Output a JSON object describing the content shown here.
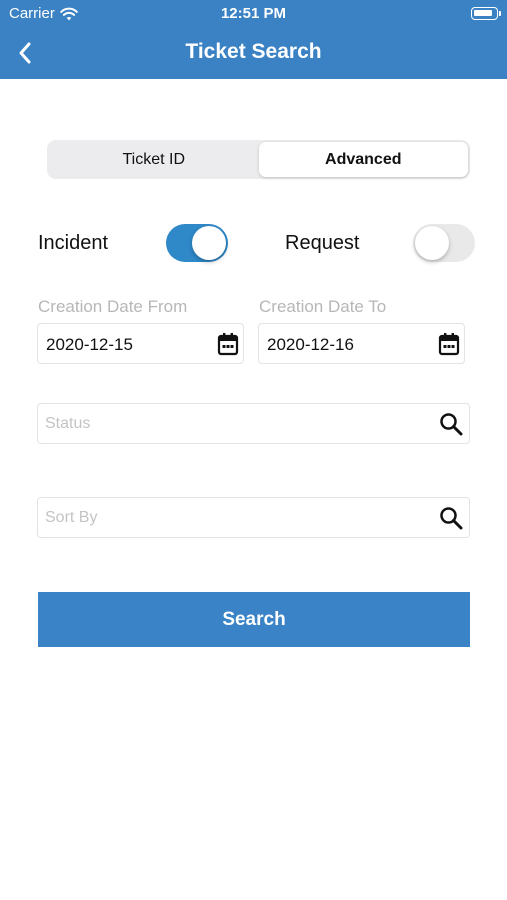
{
  "status_bar": {
    "carrier": "Carrier",
    "time": "12:51 PM"
  },
  "nav": {
    "title": "Ticket Search"
  },
  "tabs": [
    {
      "label": "Ticket ID",
      "active": false
    },
    {
      "label": "Advanced",
      "active": true
    }
  ],
  "toggles": {
    "incident": {
      "label": "Incident",
      "on": true
    },
    "request": {
      "label": "Request",
      "on": false
    }
  },
  "dates": {
    "from": {
      "label": "Creation Date From",
      "value": "2020-12-15"
    },
    "to": {
      "label": "Creation Date To",
      "value": "2020-12-16"
    }
  },
  "fields": {
    "status": {
      "placeholder": "Status",
      "value": ""
    },
    "sort_by": {
      "placeholder": "Sort By",
      "value": ""
    }
  },
  "search_button": {
    "label": "Search"
  },
  "colors": {
    "primary": "#3b82c4",
    "toggle_on": "#2f88c8",
    "toggle_off": "#e9e9ea"
  },
  "icons": [
    "wifi-icon",
    "battery-icon",
    "back-chevron-icon",
    "calendar-icon",
    "search-icon"
  ]
}
